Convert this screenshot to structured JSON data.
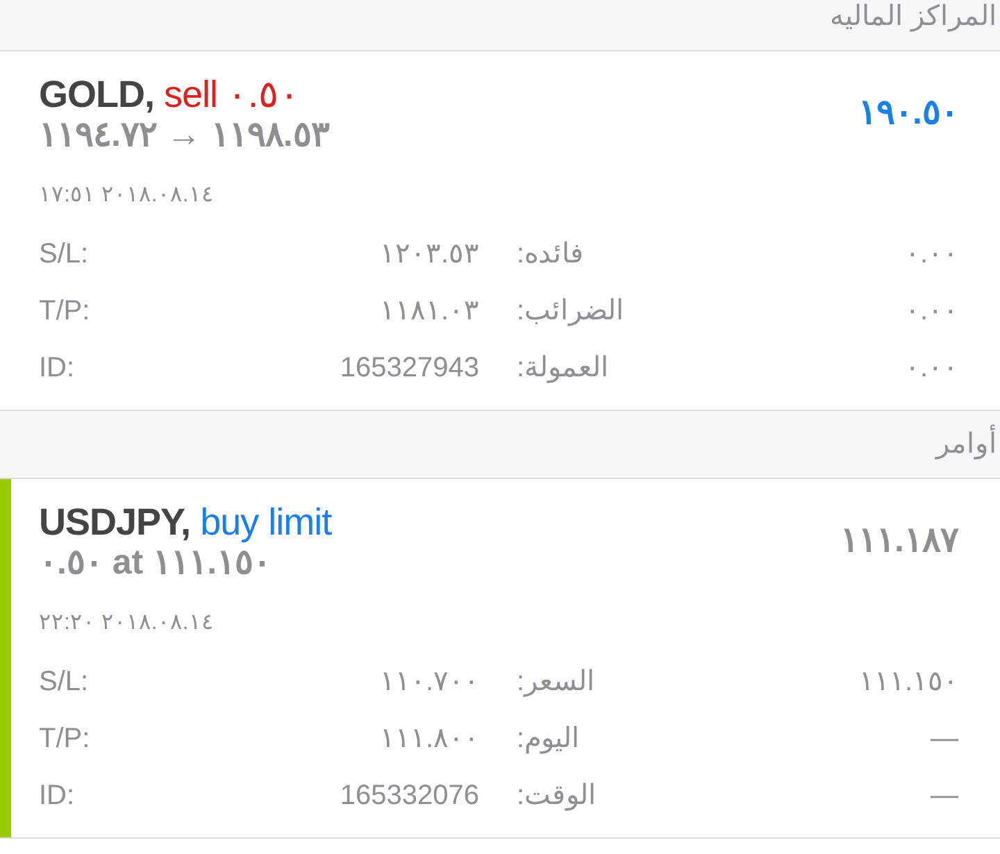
{
  "sections": [
    {
      "title": "المراكز الماليه",
      "cards": [
        {
          "kind": "position",
          "symbol": "GOLD,",
          "color": "#e0201c",
          "type": "sell ٠.٥٠",
          "subtitle": "١١٩٤.٧٢ → ١١٩٨.٥٣",
          "value": "١٩٠.٥٠",
          "time": "١٧:٥١ ٢٠١٨.٠٨.١٤",
          "rows": [
            {
              "label": "S/L:",
              "value": "١٢٠٣.٥٣",
              "label_2": "فائده:",
              "value_2": "٠.٠٠"
            },
            {
              "label": "T/P:",
              "value": "١١٨١.٠٣",
              "label_2": "الضرائب:",
              "value_2": "٠.٠٠"
            },
            {
              "label": "ID:",
              "value": "165327943",
              "label_2": "العمولة:",
              "value_2": "٠.٠٠"
            }
          ]
        }
      ]
    },
    {
      "title": "أوامر",
      "cards": [
        {
          "kind": "order",
          "symbol": "USDJPY,",
          "color": "#1a7fe8",
          "type": "buy limit",
          "subtitle": "٠.٥٠ at ١١١.١٥٠",
          "value": "١١١.١٨٧",
          "time": "٢٢:٢٠ ٢٠١٨.٠٨.١٤",
          "rows": [
            {
              "label": "S/L:",
              "value": "١١٠.٧٠٠",
              "label_2": "السعر:",
              "value_2": "١١١.١٥٠"
            },
            {
              "label": "T/P:",
              "value": "١١١.٨٠٠",
              "label_2": "اليوم:",
              "value_2": "—"
            },
            {
              "label": "ID:",
              "value": "165332076",
              "label_2": "الوقت:",
              "value_2": "—"
            }
          ]
        }
      ]
    }
  ]
}
